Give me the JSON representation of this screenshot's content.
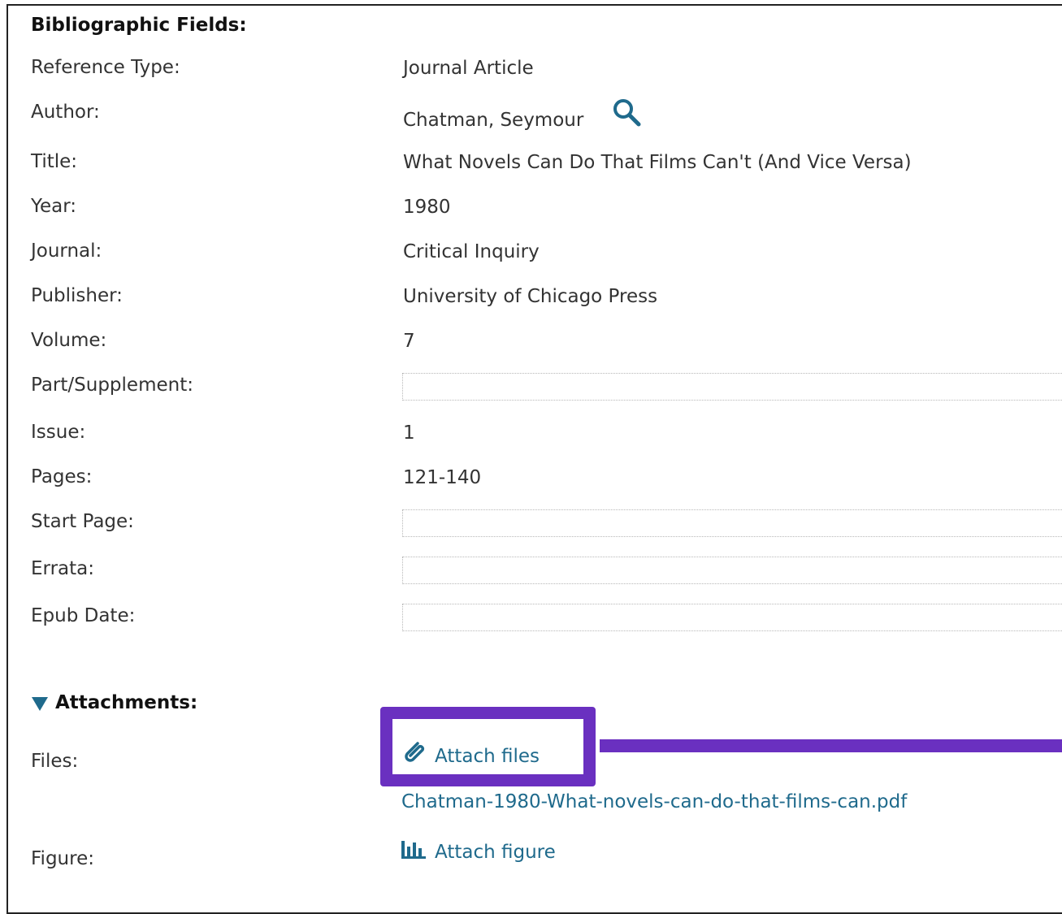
{
  "bibliographic": {
    "heading": "Bibliographic Fields:",
    "fields": [
      {
        "label": "Reference Type:",
        "value": "Journal Article"
      },
      {
        "label": "Author:",
        "value": "Chatman, Seymour"
      },
      {
        "label": "Title:",
        "value": "What Novels Can Do That Films Can't (And Vice Versa)"
      },
      {
        "label": "Year:",
        "value": "1980"
      },
      {
        "label": "Journal:",
        "value": "Critical Inquiry"
      },
      {
        "label": "Publisher:",
        "value": "University of Chicago Press"
      },
      {
        "label": "Volume:",
        "value": "7"
      },
      {
        "label": "Part/Supplement:",
        "value": ""
      },
      {
        "label": "Issue:",
        "value": "1"
      },
      {
        "label": "Pages:",
        "value": "121-140"
      },
      {
        "label": "Start Page:",
        "value": ""
      },
      {
        "label": "Errata:",
        "value": ""
      },
      {
        "label": "Epub Date:",
        "value": ""
      }
    ]
  },
  "attachments": {
    "heading": "Attachments:",
    "files_label": "Files:",
    "attach_files_label": "Attach files",
    "file_name": "Chatman-1980-What-novels-can-do-that-films-can.pdf",
    "figure_label": "Figure:",
    "attach_figure_label": "Attach figure"
  },
  "icons": {
    "author_search": "search-icon",
    "attach_files": "paperclip-icon",
    "attach_figure": "bar-chart-icon",
    "attachments_toggle": "triangle-down-icon"
  },
  "colors": {
    "link": "#1f6a8c",
    "highlight": "#6a30c0"
  }
}
